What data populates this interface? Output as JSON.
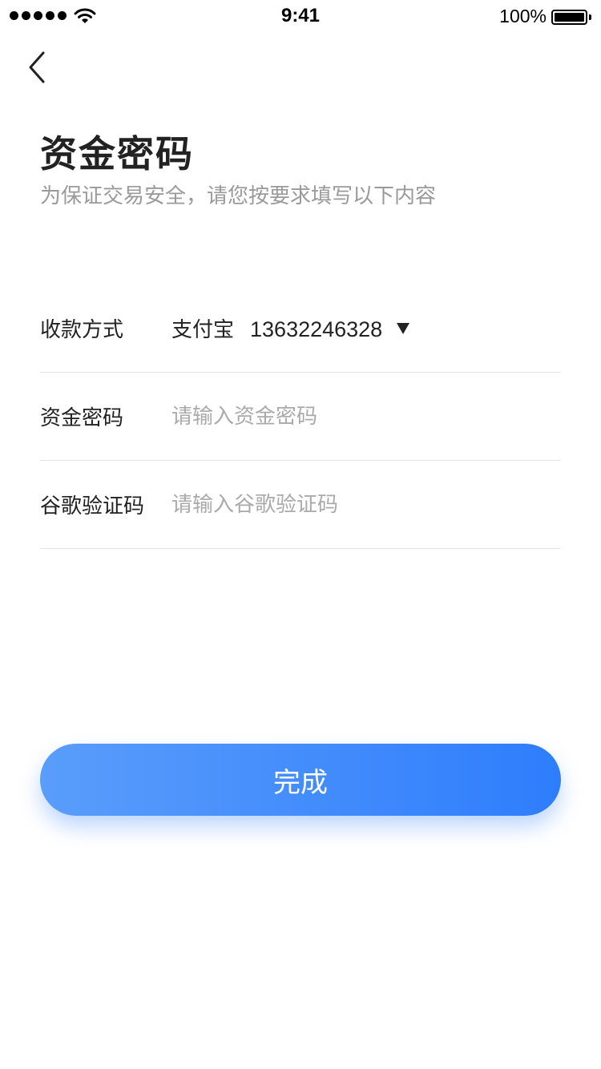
{
  "status_bar": {
    "time": "9:41",
    "battery_text": "100%",
    "icons": [
      "signal-dots-icon",
      "wifi-icon",
      "battery-icon"
    ]
  },
  "nav": {
    "back_icon": "chevron-left-icon"
  },
  "header": {
    "title": "资金密码",
    "subtitle": "为保证交易安全，请您按要求填写以下内容"
  },
  "form": {
    "payment_method": {
      "label": "收款方式",
      "method": "支付宝",
      "account": "13632246328",
      "dropdown_icon": "triangle-down-icon"
    },
    "fund_password": {
      "label": "资金密码",
      "value": "",
      "placeholder": "请输入资金密码"
    },
    "google_code": {
      "label": "谷歌验证码",
      "value": "",
      "placeholder": "请输入谷歌验证码"
    }
  },
  "submit": {
    "label": "完成"
  },
  "colors": {
    "accent_start": "#5a9dfb",
    "accent_end": "#2e7dfc",
    "placeholder": "#aaaaaa",
    "subtitle": "#9a9a9a",
    "divider": "#e5e5e5"
  }
}
